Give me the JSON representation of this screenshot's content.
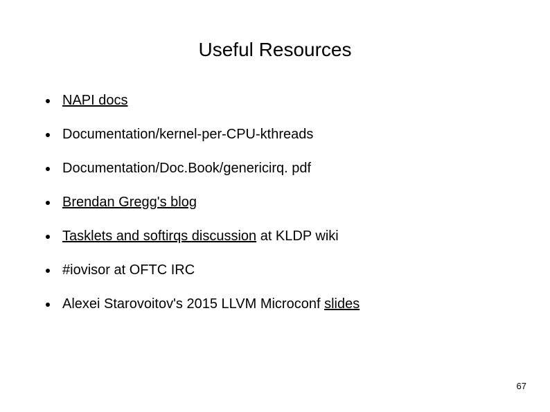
{
  "title": "Useful Resources",
  "items": [
    {
      "segments": [
        {
          "text": "NAPI docs",
          "link": true
        }
      ]
    },
    {
      "segments": [
        {
          "text": "Documentation/kernel-per-CPU-kthreads",
          "link": false
        }
      ]
    },
    {
      "segments": [
        {
          "text": "Documentation/Doc.Book/genericirq. pdf",
          "link": false
        }
      ]
    },
    {
      "segments": [
        {
          "text": "Brendan Gregg's blog",
          "link": true
        }
      ]
    },
    {
      "segments": [
        {
          "text": "Tasklets and softirqs discussion",
          "link": true
        },
        {
          "text": " at KLDP wiki",
          "link": false
        }
      ]
    },
    {
      "segments": [
        {
          "text": "#iovisor at OFTC IRC",
          "link": false
        }
      ]
    },
    {
      "segments": [
        {
          "text": "Alexei Starovoitov's 2015 LLVM Microconf ",
          "link": false
        },
        {
          "text": "slides",
          "link": true
        }
      ]
    }
  ],
  "page_number": "67"
}
